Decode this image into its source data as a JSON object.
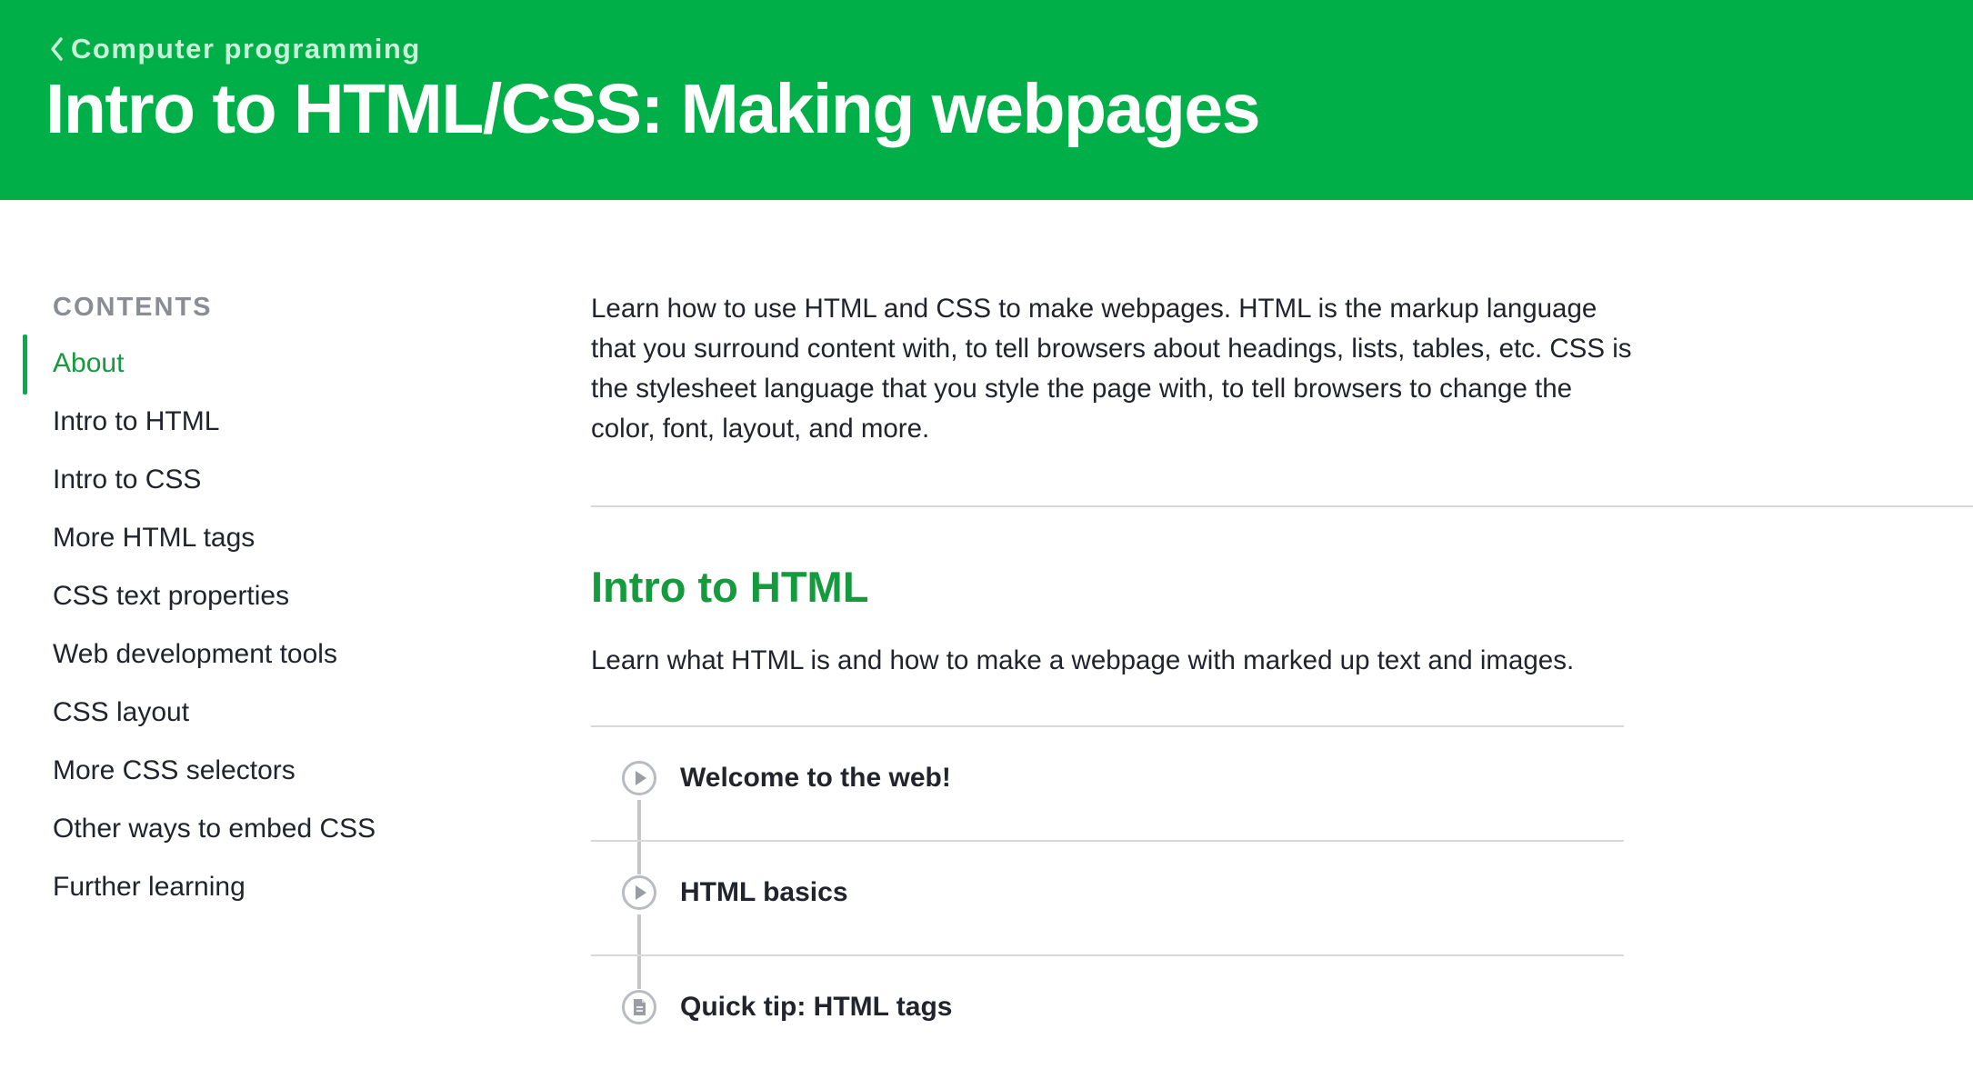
{
  "header": {
    "back_label": "Computer programming",
    "title": "Intro to HTML/CSS: Making webpages",
    "bg_color": "#00af47"
  },
  "sidebar": {
    "heading": "CONTENTS",
    "active_index": 0,
    "items": [
      {
        "label": "About"
      },
      {
        "label": "Intro to HTML"
      },
      {
        "label": "Intro to CSS"
      },
      {
        "label": "More HTML tags"
      },
      {
        "label": "CSS text properties"
      },
      {
        "label": "Web development tools"
      },
      {
        "label": "CSS layout"
      },
      {
        "label": "More CSS selectors"
      },
      {
        "label": "Other ways to embed CSS"
      },
      {
        "label": "Further learning"
      }
    ]
  },
  "main": {
    "about_text": "Learn how to use HTML and CSS to make webpages. HTML is the markup language that you surround content with, to tell browsers about headings, lists, tables, etc. CSS is the stylesheet language that you style the page with, to tell browsers to change the color, font, layout, and more.",
    "section": {
      "title": "Intro to HTML",
      "description": "Learn what HTML is and how to make a webpage with marked up text and images.",
      "lessons": [
        {
          "title": "Welcome to the web!",
          "icon": "play-icon"
        },
        {
          "title": "HTML basics",
          "icon": "play-icon"
        },
        {
          "title": "Quick tip: HTML tags",
          "icon": "document-icon"
        }
      ]
    }
  }
}
